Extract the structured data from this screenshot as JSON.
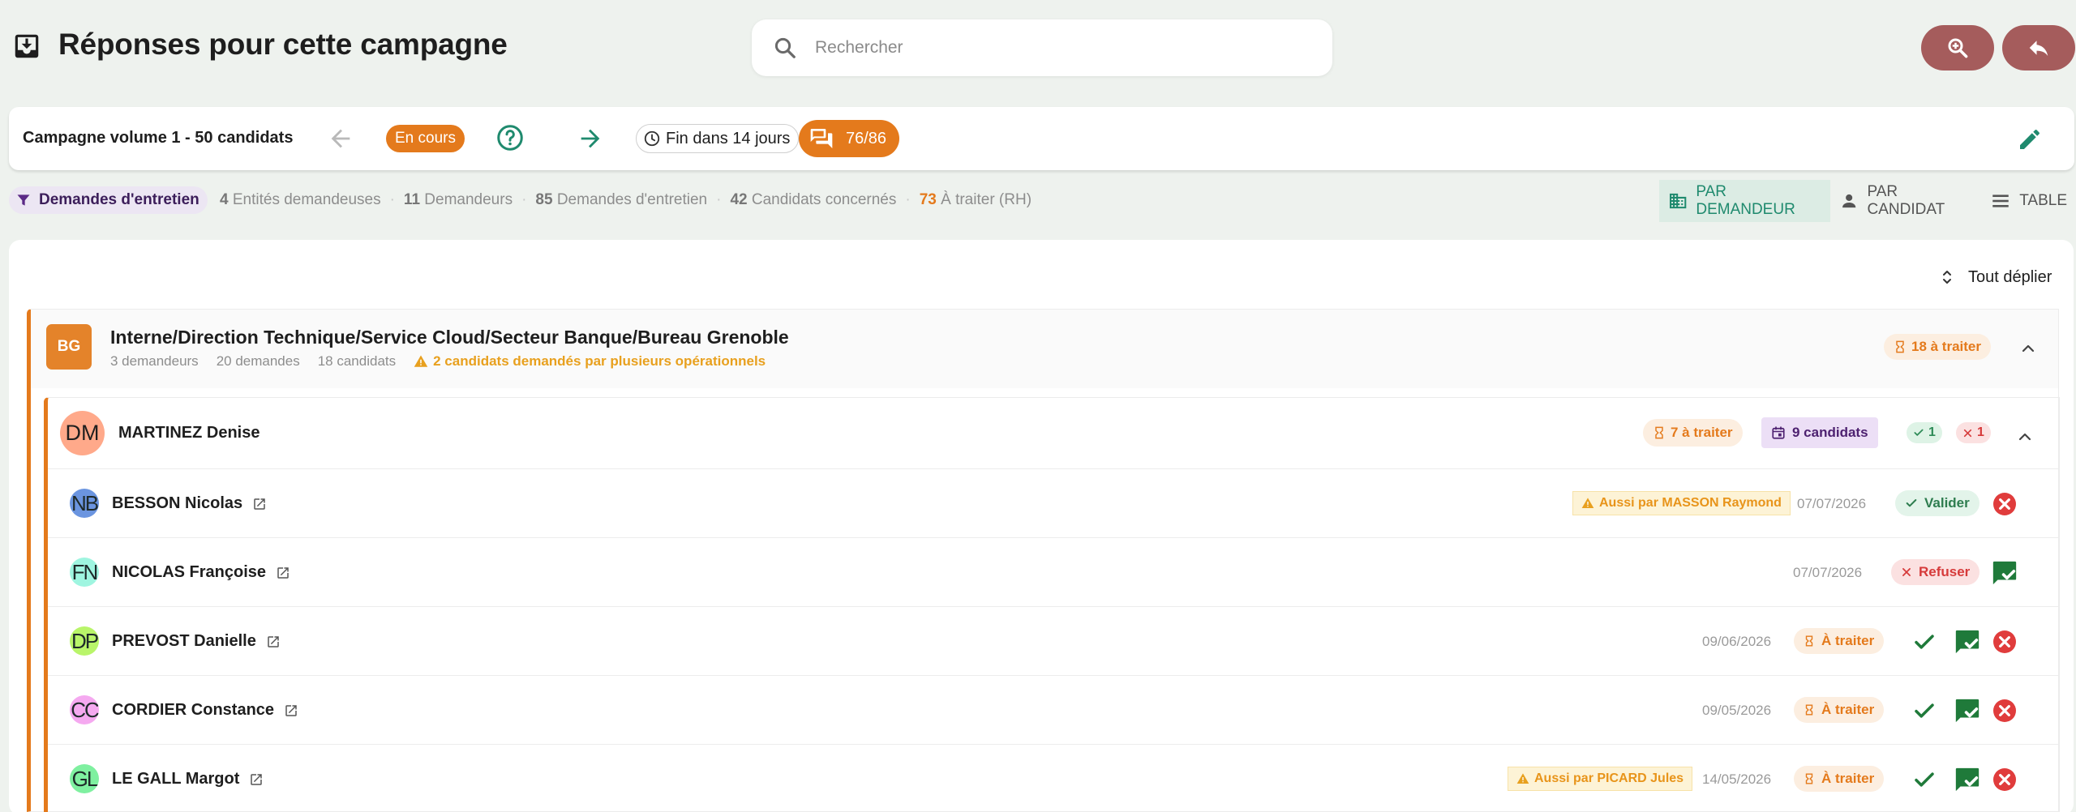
{
  "header": {
    "title": "Réponses pour cette campagne",
    "search_placeholder": "Rechercher"
  },
  "campaign": {
    "name": "Campagne volume 1 - 50 candidats",
    "status": "En cours",
    "end": "Fin dans 14 jours",
    "responses": "76/86"
  },
  "filter": {
    "label": "Demandes d'entretien"
  },
  "stats": [
    {
      "value": "4",
      "label": "Entités demandeuses"
    },
    {
      "value": "11",
      "label": "Demandeurs"
    },
    {
      "value": "85",
      "label": "Demandes d'entretien"
    },
    {
      "value": "42",
      "label": "Candidats concernés"
    },
    {
      "value": "73",
      "label": "À traiter (RH)"
    }
  ],
  "views": {
    "by_requester": "PAR DEMANDEUR",
    "by_candidate": "PAR CANDIDAT",
    "table": "TABLE"
  },
  "expand_all": "Tout déplier",
  "group": {
    "initials": "BG",
    "title": "Interne/Direction Technique/Service Cloud/Secteur Banque/Bureau Grenoble",
    "requesters": "3 demandeurs",
    "requests": "20 demandes",
    "candidates": "18 candidats",
    "warning": "2 candidats demandés par plusieurs opérationnels",
    "pending": "18 à traiter"
  },
  "requester": {
    "initials": "DM",
    "name": "MARTINEZ Denise",
    "pending": "7 à traiter",
    "candidates": "9 candidats",
    "accepted": "1",
    "refused": "1"
  },
  "candidates": [
    {
      "initials": "NB",
      "name": "BESSON Nicolas",
      "also": "Aussi par MASSON Raymond",
      "date": "07/07/2026",
      "status": "Valider"
    },
    {
      "initials": "FN",
      "name": "NICOLAS Françoise",
      "also": "",
      "date": "07/07/2026",
      "status": "Refuser"
    },
    {
      "initials": "DP",
      "name": "PREVOST Danielle",
      "also": "",
      "date": "09/06/2026",
      "status": "À traiter"
    },
    {
      "initials": "CC",
      "name": "CORDIER Constance",
      "also": "",
      "date": "09/05/2026",
      "status": "À traiter"
    },
    {
      "initials": "GL",
      "name": "LE GALL Margot",
      "also": "Aussi par PICARD Jules",
      "date": "14/05/2026",
      "status": "À traiter"
    }
  ],
  "colors": {
    "accent_orange": "#e47a1c",
    "brand_brown": "#a55c5c",
    "teal": "#1f8a6e",
    "success_green": "#2e7d4f",
    "danger_red": "#e03c3c",
    "purple": "#4d2170"
  },
  "icons": [
    "inbox-download-icon",
    "search-icon",
    "zoom-in-icon",
    "reply-icon",
    "arrow-left-icon",
    "help-circle-icon",
    "arrow-right-icon",
    "clock-icon",
    "chat-icon",
    "pencil-icon",
    "filter-icon",
    "building-icon",
    "person-icon",
    "list-icon",
    "unfold-icon",
    "hourglass-icon",
    "warning-icon",
    "chevron-up-icon",
    "calendar-icon",
    "check-icon",
    "close-icon",
    "external-link-icon",
    "chat-check-icon",
    "cancel-circle-icon"
  ]
}
